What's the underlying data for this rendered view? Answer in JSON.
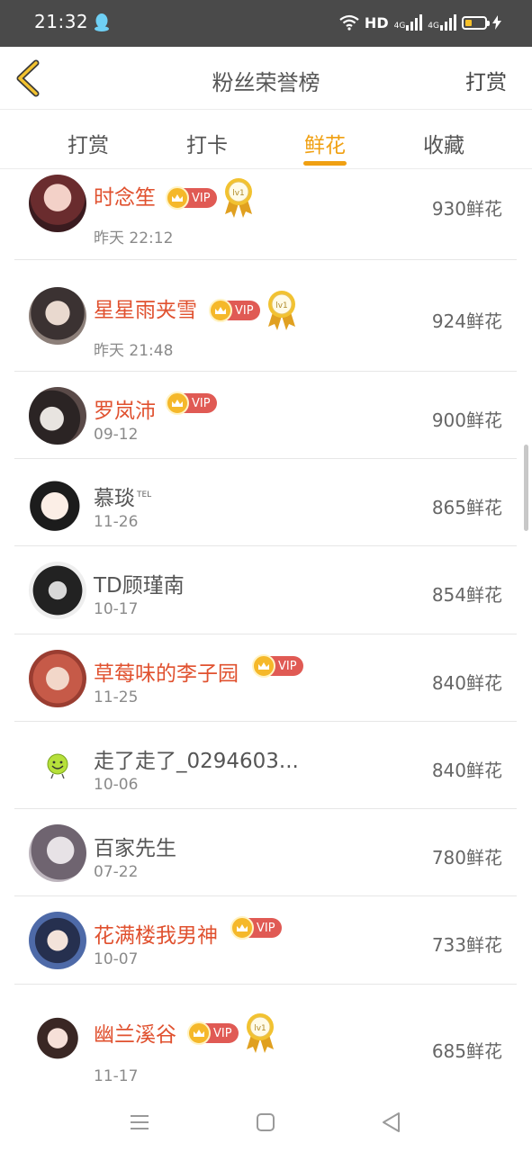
{
  "status": {
    "time": "21:32",
    "network": "HD",
    "sig1": "4G",
    "sig2": "4G"
  },
  "header": {
    "title": "粉丝荣誉榜",
    "action_label": "打赏"
  },
  "tabs": [
    {
      "label": "打赏",
      "active": false
    },
    {
      "label": "打卡",
      "active": false
    },
    {
      "label": "鲜花",
      "active": true
    },
    {
      "label": "收藏",
      "active": false
    }
  ],
  "rows": [
    {
      "name": "时念笙",
      "date": "昨天 22:12",
      "amount": "930鲜花",
      "vip": true,
      "vip_label": "VIP",
      "medal": true,
      "medal_label": "lv1"
    },
    {
      "name": "星星雨夹雪",
      "date": "昨天 21:48",
      "amount": "924鲜花",
      "vip": true,
      "vip_label": "VIP",
      "medal": true,
      "medal_label": "lv1"
    },
    {
      "name": "罗岚沛",
      "date": "09-12",
      "amount": "900鲜花",
      "vip": true,
      "vip_label": "VIP",
      "medal": false
    },
    {
      "name": "慕琰",
      "suffix": "TEL",
      "date": "11-26",
      "amount": "865鲜花",
      "vip": false,
      "medal": false
    },
    {
      "name": "TD顾瑾南",
      "date": "10-17",
      "amount": "854鲜花",
      "vip": false,
      "medal": false
    },
    {
      "name": "草莓味的李子园",
      "date": "11-25",
      "amount": "840鲜花",
      "vip": true,
      "vip_label": "VIP",
      "medal": false
    },
    {
      "name": "走了走了_0294603...",
      "date": "10-06",
      "amount": "840鲜花",
      "vip": false,
      "medal": false
    },
    {
      "name": "百家先生",
      "date": "07-22",
      "amount": "780鲜花",
      "vip": false,
      "medal": false
    },
    {
      "name": "花满楼我男神",
      "date": "10-07",
      "amount": "733鲜花",
      "vip": true,
      "vip_label": "VIP",
      "medal": false
    },
    {
      "name": "幽兰溪谷",
      "date": "11-17",
      "amount": "685鲜花",
      "vip": true,
      "vip_label": "VIP",
      "medal": true,
      "medal_label": "lv1"
    }
  ],
  "colors": {
    "accent": "#f0a012",
    "vip_name": "#e0512f",
    "vip_badge": "#e05a54",
    "status_bar": "#4a4a4a"
  },
  "icons": {
    "back": "chevron-left-icon",
    "menu": "menu-icon",
    "home": "home-square-icon",
    "back_nav": "triangle-back-icon"
  }
}
